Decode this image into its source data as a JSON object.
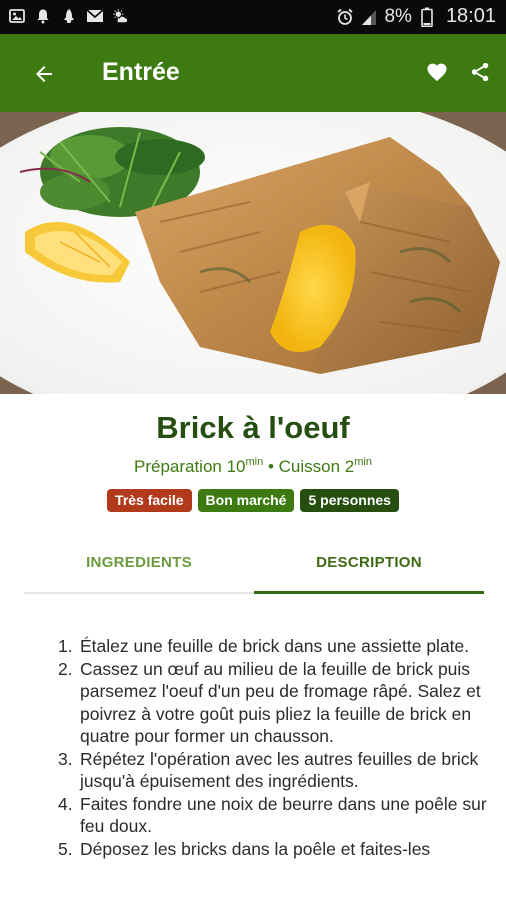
{
  "status_bar": {
    "battery": "8%",
    "time": "18:01",
    "left_icons": [
      "photo-icon",
      "notification-bell-icon",
      "app-icon",
      "mail-icon",
      "weather-icon"
    ],
    "right_icons": [
      "alarm-icon",
      "signal-icon",
      "battery-icon"
    ]
  },
  "appbar": {
    "title": "Entrée",
    "icons": [
      "back-arrow-icon",
      "heart-icon",
      "share-icon"
    ],
    "color": "#3e7a12"
  },
  "recipe": {
    "title": "Brick à l'oeuf",
    "prep_label": "Préparation 10",
    "prep_unit": "min",
    "separator": " • ",
    "cook_label": "Cuisson 2",
    "cook_unit": "min",
    "badges": {
      "difficulty": "Très facile",
      "cost": "Bon marché",
      "servings": "5 personnes"
    }
  },
  "tabs": {
    "ingredients": "INGREDIENTS",
    "description": "DESCRIPTION",
    "active": "description"
  },
  "steps": [
    {
      "n": "1.",
      "text": "Étalez une feuille de brick dans une assiette plate."
    },
    {
      "n": "2.",
      "text": "Cassez un œuf au milieu de la feuille de brick puis parsemez l'oeuf d'un peu de fromage râpé. Salez et poivrez à votre goût puis pliez la feuille de brick en quatre pour former un chausson."
    },
    {
      "n": "3.",
      "text": "Répétez l'opération avec les autres feuilles de brick jusqu'à épuisement des ingrédients."
    },
    {
      "n": "4.",
      "text": "Faites fondre une noix de beurre dans une poêle sur feu doux."
    },
    {
      "n": "5.",
      "text": "Déposez les bricks dans la poêle et faites-les"
    }
  ]
}
